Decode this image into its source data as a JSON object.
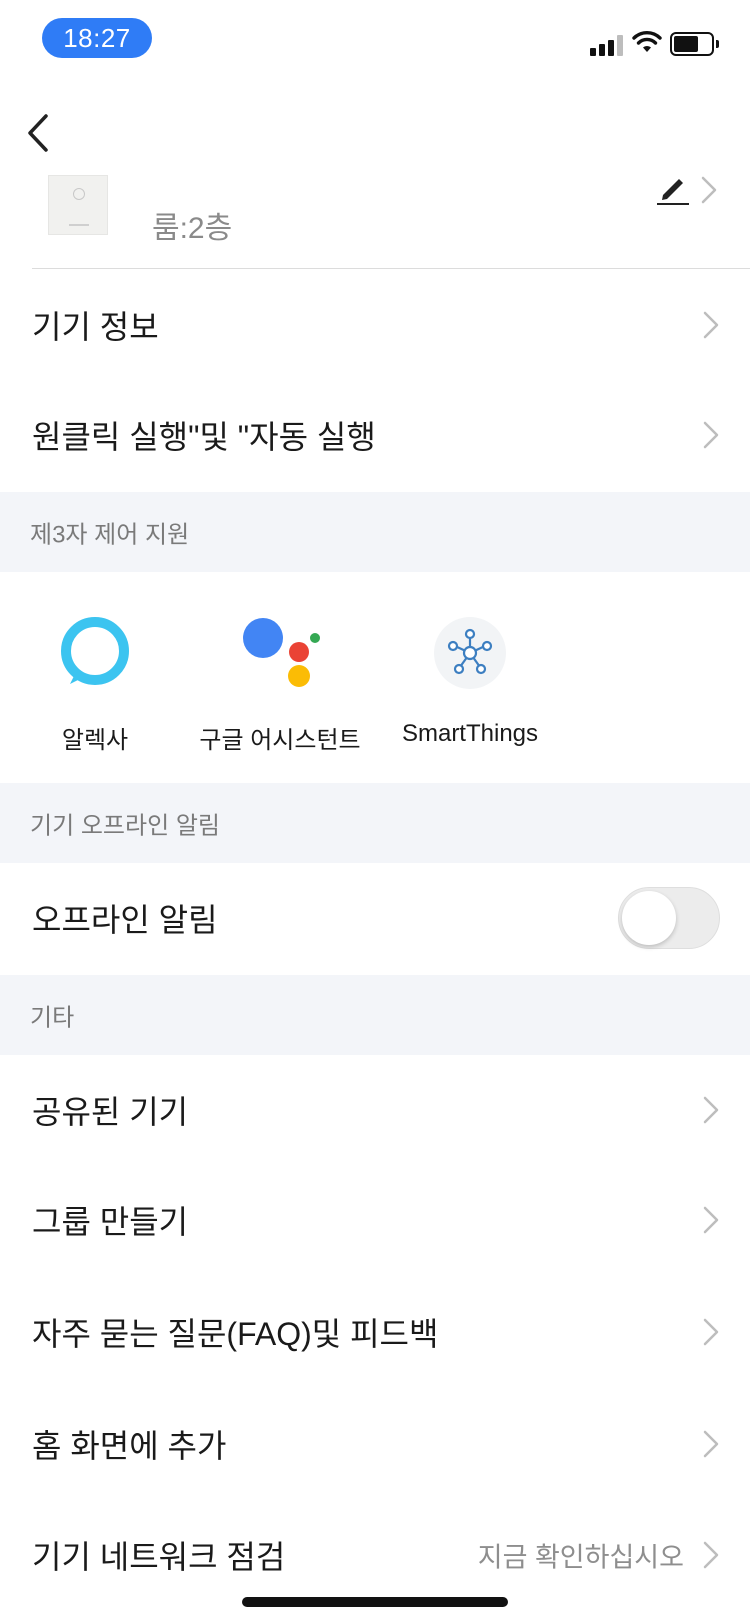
{
  "status_bar": {
    "time": "18:27"
  },
  "device": {
    "room": "룸:2층"
  },
  "main_rows": [
    {
      "label": "기기 정보"
    },
    {
      "label": "원클릭 실행\"및 \"자동 실행"
    }
  ],
  "third_party": {
    "header": "제3자 제어 지원",
    "items": [
      {
        "label": "알렉사",
        "icon": "alexa-icon"
      },
      {
        "label": "구글 어시스턴트",
        "icon": "google-assistant-icon"
      },
      {
        "label": "SmartThings",
        "icon": "smartthings-icon"
      }
    ]
  },
  "offline": {
    "header": "기기 오프라인 알림",
    "label": "오프라인 알림",
    "enabled": false
  },
  "other": {
    "header": "기타",
    "rows": [
      {
        "label": "공유된 기기"
      },
      {
        "label": "그룹 만들기"
      },
      {
        "label": "자주 묻는 질문(FAQ)및 피드백"
      },
      {
        "label": "홈 화면에 추가"
      },
      {
        "label": "기기 네트워크 점검",
        "value": "지금 확인하십시오"
      }
    ]
  },
  "colors": {
    "accent": "#2f7cf6",
    "section_bg": "#f3f5f9",
    "alexa": "#3cc4f0",
    "google_blue": "#4285f4",
    "google_red": "#ea4335",
    "google_yellow": "#fbbc05",
    "google_green": "#34a853"
  }
}
